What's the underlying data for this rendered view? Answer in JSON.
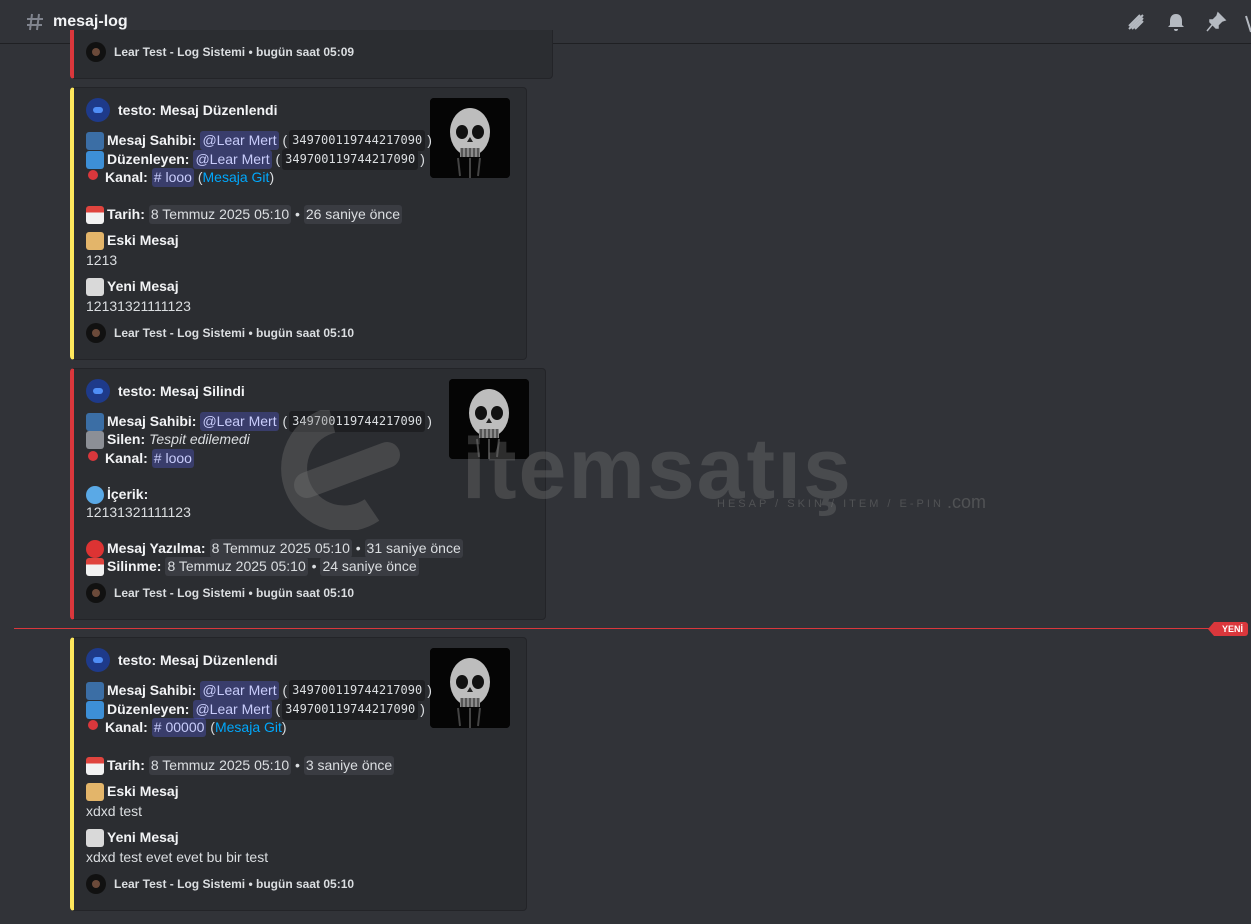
{
  "header": {
    "channel_name": "mesaj-log",
    "icons": [
      "threads-icon",
      "bell-icon",
      "pin-icon"
    ]
  },
  "top_partial_footer": "Lear Test - Log Sistemi • bugün saat 05:09",
  "embeds": [
    {
      "author": "testo: Mesaj Düzenlendi",
      "owner_label": "Mesaj Sahibi:",
      "owner_mention": "@Lear Mert",
      "owner_id": "349700119744217090",
      "editor_label": "Düzenleyen:",
      "editor_mention": "@Lear Mert",
      "editor_id": "349700119744217090",
      "channel_label": "Kanal:",
      "channel_mention": "# looo",
      "jump_link": "Mesaja Git",
      "date_label": "Tarih:",
      "date_value": "8 Temmuz 2025 05:10",
      "date_relative": "26 saniye önce",
      "old_label": "Eski Mesaj",
      "old_value": "1213",
      "new_label": "Yeni Mesaj",
      "new_value": "12131321111123",
      "footer": "Lear Test - Log Sistemi • bugün saat 05:10"
    },
    {
      "author": "testo: Mesaj Silindi",
      "owner_label": "Mesaj Sahibi:",
      "owner_mention": "@Lear Mert",
      "owner_id": "349700119744217090",
      "deleter_label": "Silen:",
      "deleter_value": "Tespit edilemedi",
      "channel_label": "Kanal:",
      "channel_mention": "# looo",
      "content_label": "İçerik:",
      "content_value": "12131321111123",
      "written_label": "Mesaj Yazılma:",
      "written_value": "8 Temmuz 2025 05:10",
      "written_relative": "31 saniye önce",
      "deleted_label": "Silinme:",
      "deleted_value": "8 Temmuz 2025 05:10",
      "deleted_relative": "24 saniye önce",
      "footer": "Lear Test - Log Sistemi • bugün saat 05:10"
    },
    {
      "author": "testo: Mesaj Düzenlendi",
      "owner_label": "Mesaj Sahibi:",
      "owner_mention": "@Lear Mert",
      "owner_id": "349700119744217090",
      "editor_label": "Düzenleyen:",
      "editor_mention": "@Lear Mert",
      "editor_id": "349700119744217090",
      "channel_label": "Kanal:",
      "channel_mention": "# 00000",
      "jump_link": "Mesaja Git",
      "date_label": "Tarih:",
      "date_value": "8 Temmuz 2025 05:10",
      "date_relative": "3 saniye önce",
      "old_label": "Eski Mesaj",
      "old_value": "xdxd test",
      "new_label": "Yeni Mesaj",
      "new_value": "xdxd test evet evet bu bir test",
      "footer": "Lear Test - Log Sistemi • bugün saat 05:10"
    }
  ],
  "divider_badge": "YENİ",
  "watermark": {
    "brand": "itemsatış",
    "tagline": "HESAP / SKIN / ITEM / E-PIN",
    "suffix": ".com"
  },
  "colors": {
    "background": "#313338",
    "embed_bg": "#2b2d31",
    "edit_accent": "#fee75c",
    "delete_accent": "#da373c",
    "new_divider": "#da373c",
    "link": "#00a8fc"
  }
}
